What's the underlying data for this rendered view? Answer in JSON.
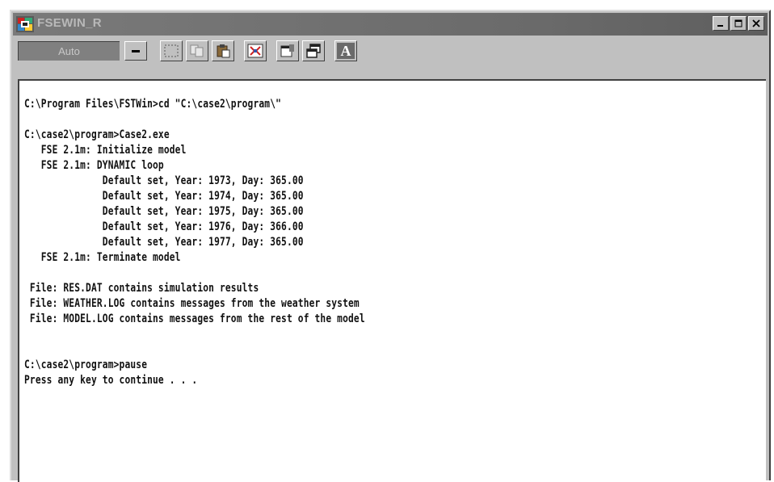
{
  "window": {
    "title": "FSEWIN_R",
    "controls": [
      "minimize",
      "maximize",
      "close"
    ]
  },
  "toolbar": {
    "font_select_value": "Auto",
    "buttons": [
      {
        "name": "mark-icon"
      },
      {
        "name": "copy-icon"
      },
      {
        "name": "paste-icon"
      },
      {
        "name": "full-screen-icon"
      },
      {
        "name": "properties-icon"
      },
      {
        "name": "background-icon"
      },
      {
        "name": "font-icon",
        "label": "A"
      }
    ]
  },
  "console": {
    "lines": [
      "C:\\Program Files\\FSTWin>cd \"C:\\case2\\program\\\"",
      "",
      "C:\\case2\\program>Case2.exe",
      "   FSE 2.1m: Initialize model",
      "   FSE 2.1m: DYNAMIC loop",
      "              Default set, Year: 1973, Day: 365.00",
      "              Default set, Year: 1974, Day: 365.00",
      "              Default set, Year: 1975, Day: 365.00",
      "              Default set, Year: 1976, Day: 366.00",
      "              Default set, Year: 1977, Day: 365.00",
      "   FSE 2.1m: Terminate model",
      "",
      " File: RES.DAT contains simulation results",
      " File: WEATHER.LOG contains messages from the weather system",
      " File: MODEL.LOG contains messages from the rest of the model",
      "",
      "",
      "C:\\case2\\program>pause",
      "Press any key to continue . . ."
    ]
  }
}
